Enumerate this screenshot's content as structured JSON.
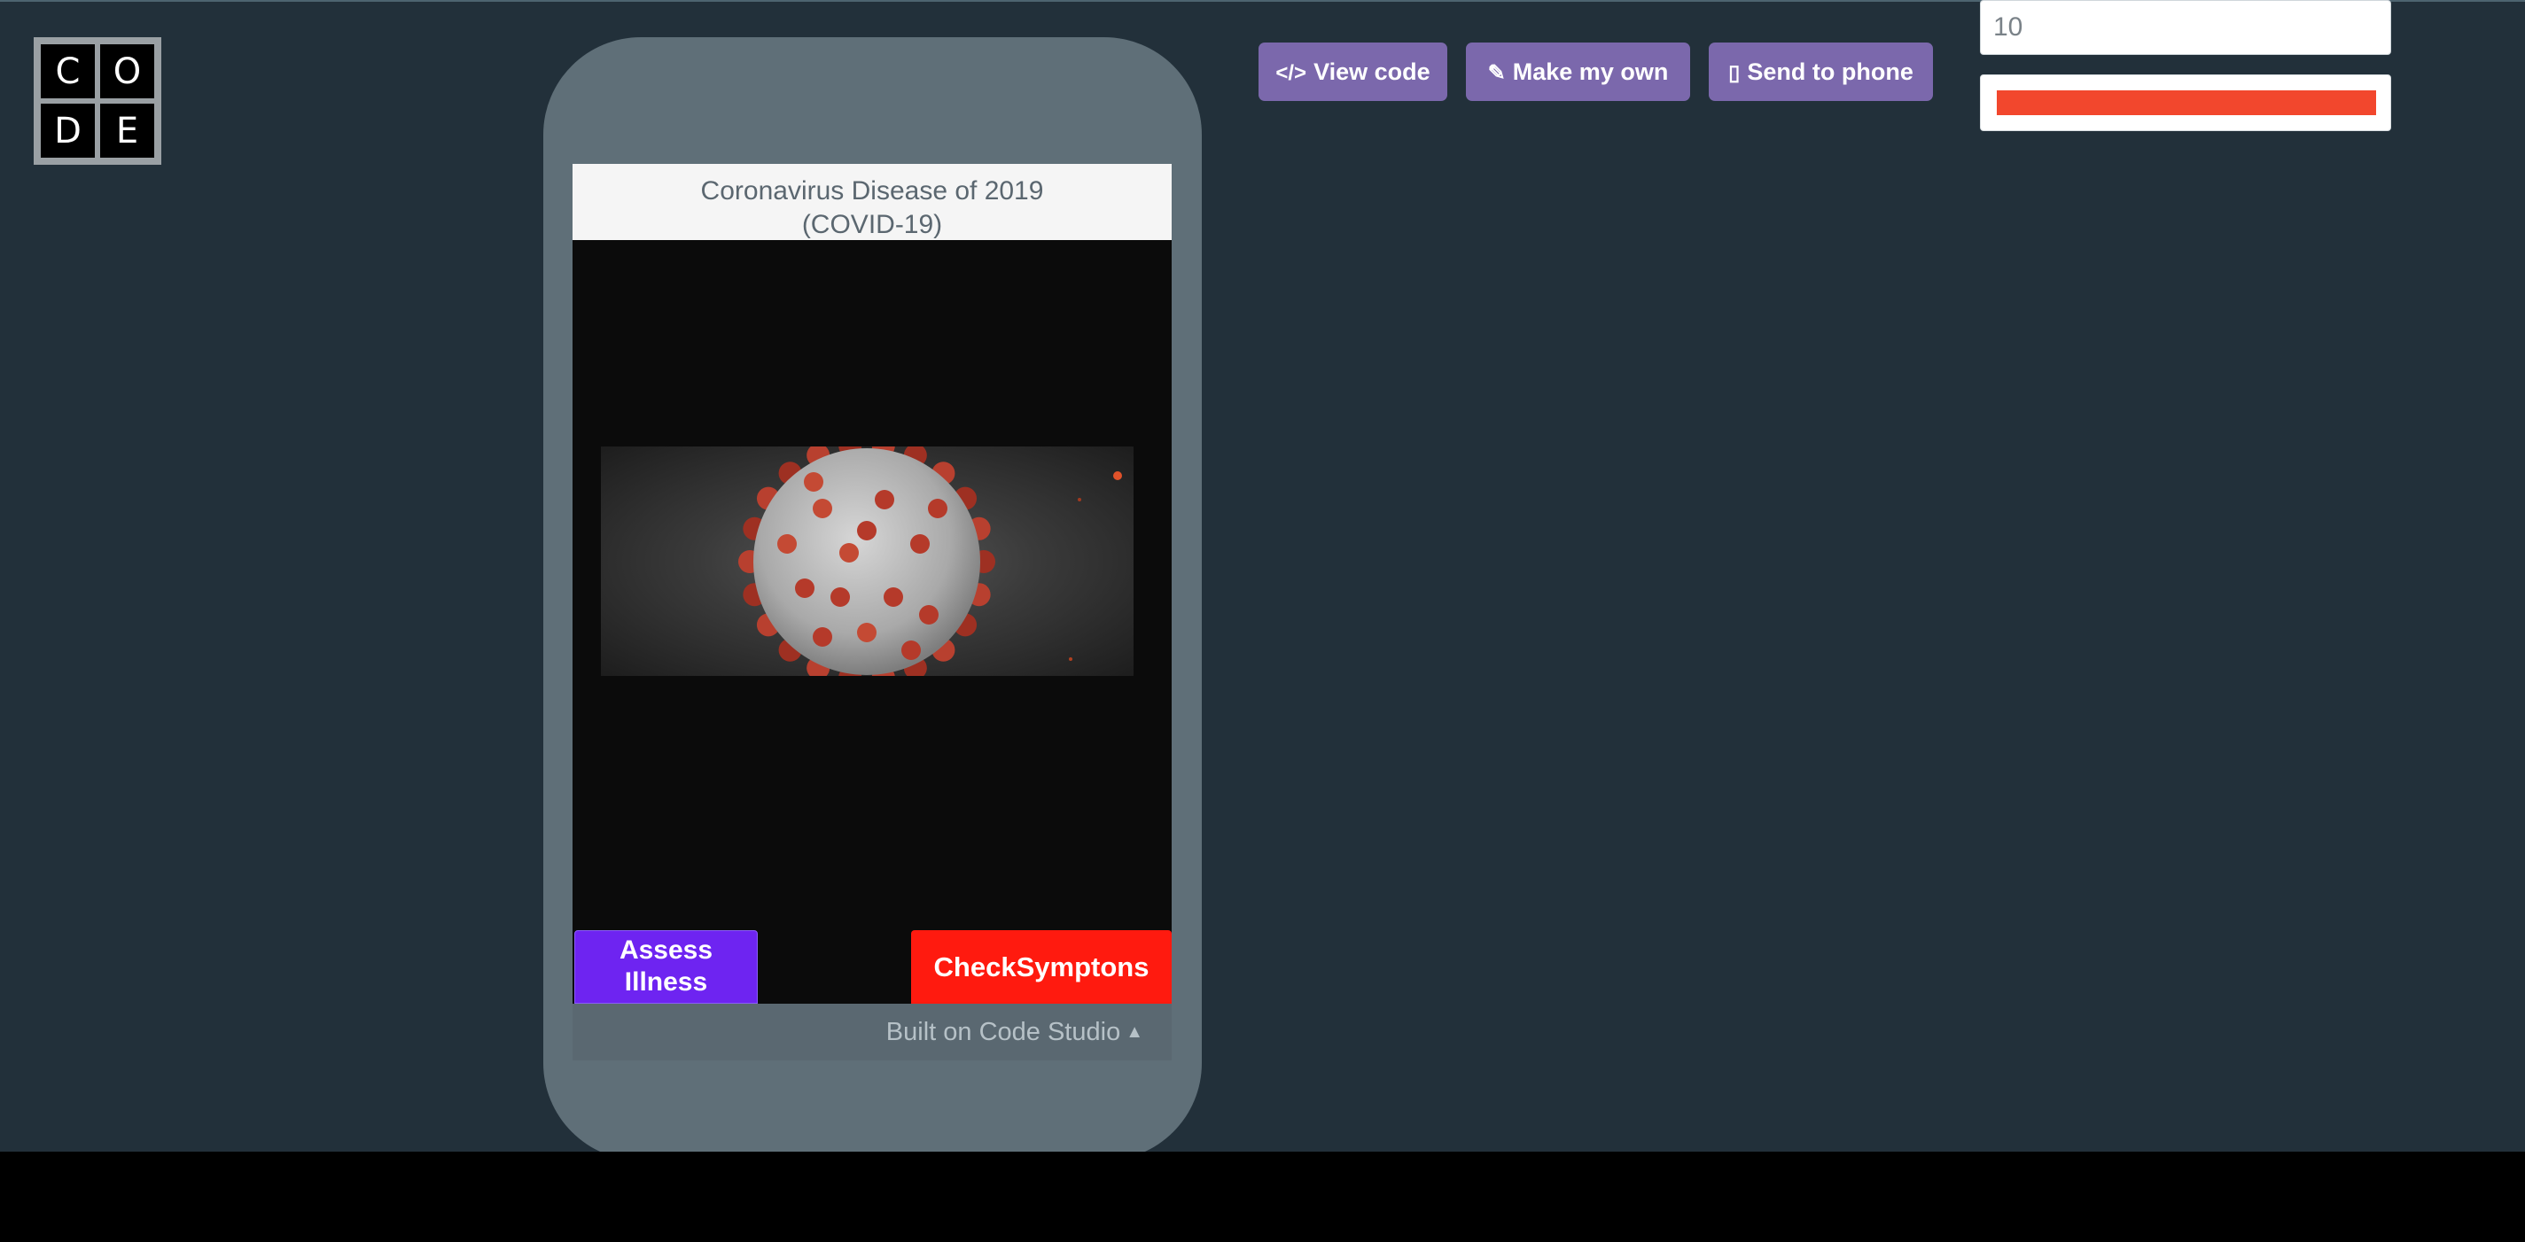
{
  "logo": {
    "letters": [
      "C",
      "O",
      "D",
      "E"
    ]
  },
  "app": {
    "title_line1": "Coronavirus Disease of 2019",
    "title_line2": "(COVID-19)",
    "assess_button_line1": "Assess",
    "assess_button_line2": "Illness",
    "check_button_label": "CheckSymptons",
    "built_on_label": "Built on Code Studio",
    "colors": {
      "assess": "#6e24f1",
      "check": "#ff1a0f"
    }
  },
  "toolbar": {
    "view_code_label": "View code",
    "make_my_own_label": "Make my own",
    "send_to_phone_label": "Send to phone",
    "view_code_icon": "code-icon",
    "make_my_own_icon": "edit-icon",
    "send_to_phone_icon": "phone-icon"
  },
  "controls": {
    "number_value": "10",
    "progress_fraction": 1.0,
    "progress_color": "#f2472d"
  }
}
